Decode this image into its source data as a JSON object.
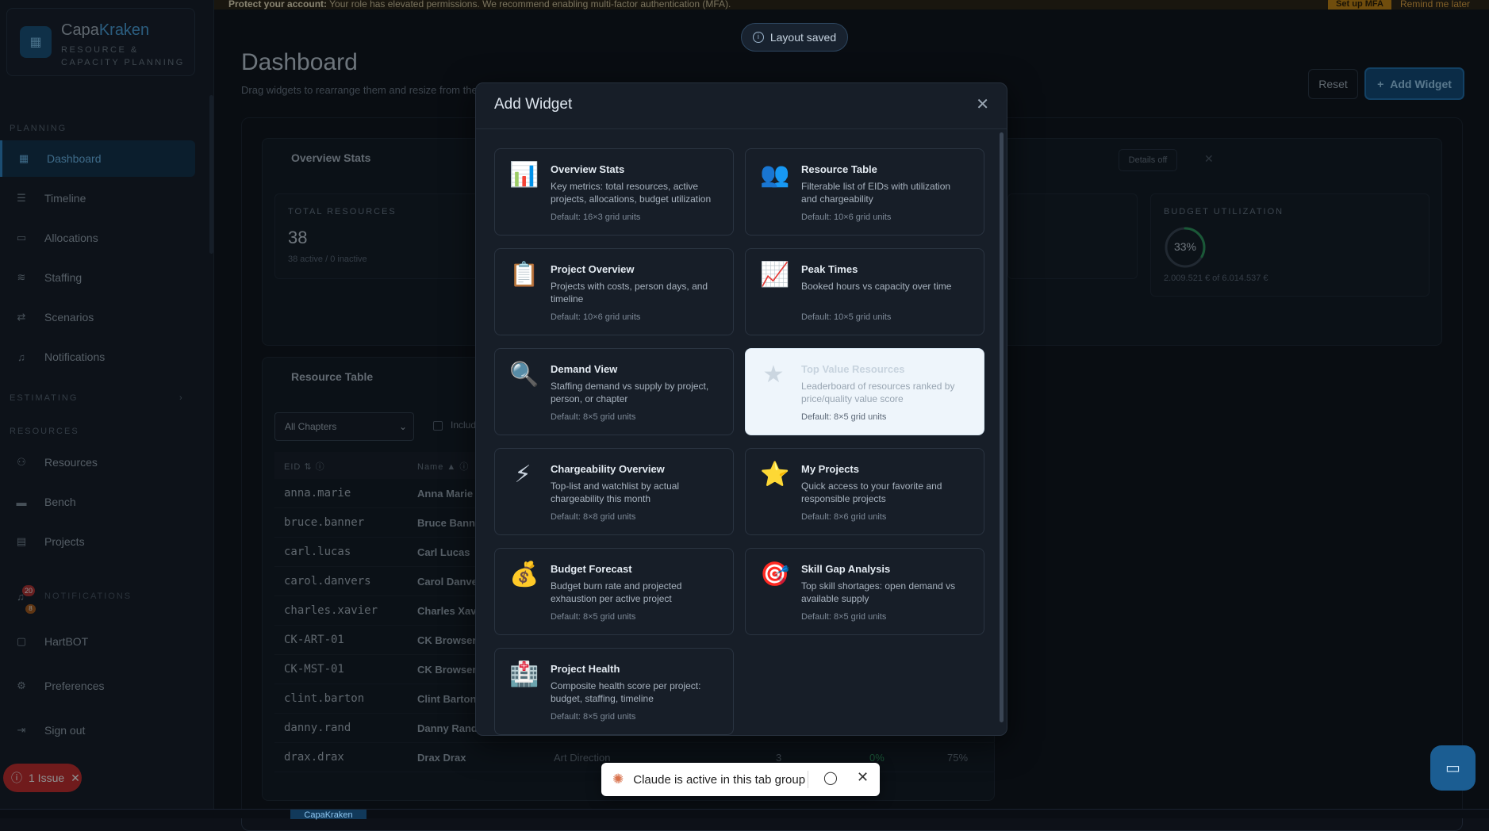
{
  "banner": {
    "bold": "Protect your account:",
    "text": " Your role has elevated permissions. We recommend enabling multi-factor authentication (MFA).",
    "mfa_button": "Set up MFA",
    "later_link": "Remind me later"
  },
  "brand": {
    "name_a": "Capa",
    "name_b": "Kraken",
    "subtitle": "RESOURCE & CAPACITY PLANNING"
  },
  "sidebar": {
    "planning_label": "PLANNING",
    "planning_items": [
      "Dashboard",
      "Timeline",
      "Allocations",
      "Staffing",
      "Scenarios",
      "Notifications"
    ],
    "estimating_label": "ESTIMATING",
    "resources_label": "RESOURCES",
    "resources_items": [
      "Resources",
      "Bench",
      "Projects"
    ],
    "notifications_label": "NOTIFICATIONS",
    "badge_red": "20",
    "badge_orange": "8",
    "bottom_items": [
      "HartBOT",
      "Preferences",
      "Sign out"
    ],
    "issue_label": "1 Issue"
  },
  "main": {
    "title": "Dashboard",
    "subtitle": "Drag widgets to rearrange them and resize from the",
    "reset": "Reset",
    "add_widget": "Add Widget",
    "overview_title": "Overview Stats",
    "details_off": "Details off",
    "stats": [
      {
        "label": "TOTAL RESOURCES",
        "value": "38",
        "sub": "38 active / 0 inactive"
      },
      {
        "label": "BUDGET UTILIZATION",
        "value": "33%",
        "sub": "2.009.521 € of 6.014.537 €",
        "percent": 33
      }
    ],
    "resource_table_title": "Resource Table",
    "chapter_select": "All Chapters",
    "include_label": "Includ",
    "col_eid": "EID",
    "col_name": "Name",
    "rows": [
      {
        "eid": "anna.marie",
        "name": "Anna Marie"
      },
      {
        "eid": "bruce.banner",
        "name": "Bruce Banne"
      },
      {
        "eid": "carl.lucas",
        "name": "Carl Lucas"
      },
      {
        "eid": "carol.danvers",
        "name": "Carol Danve"
      },
      {
        "eid": "charles.xavier",
        "name": "Charles Xavi"
      },
      {
        "eid": "CK-ART-01",
        "name": "CK Browser"
      },
      {
        "eid": "CK-MST-01",
        "name": "CK Browser"
      },
      {
        "eid": "clint.barton",
        "name": "Clint Barton"
      },
      {
        "eid": "danny.rand",
        "name": "Danny Rand"
      },
      {
        "eid": "drax.drax",
        "name": "Drax Drax",
        "chapter": "Art Direction",
        "n1": "3",
        "n2": "0%",
        "n3": "75%"
      }
    ]
  },
  "toast": {
    "text": "Layout saved"
  },
  "modal": {
    "title": "Add Widget",
    "widgets": [
      {
        "icon": "📊",
        "title": "Overview Stats",
        "desc": "Key metrics: total resources, active projects, allocations, budget utilization",
        "grid": "Default: 16×3 grid units"
      },
      {
        "icon": "👥",
        "title": "Resource Table",
        "desc": "Filterable list of EIDs with utilization and chargeability",
        "grid": "Default: 10×6 grid units"
      },
      {
        "icon": "📋",
        "title": "Project Overview",
        "desc": "Projects with costs, person days, and timeline",
        "grid": "Default: 10×6 grid units"
      },
      {
        "icon": "📈",
        "title": "Peak Times",
        "desc": "Booked hours vs capacity over time",
        "grid": "Default: 10×5 grid units"
      },
      {
        "icon": "🔍",
        "title": "Demand View",
        "desc": "Staffing demand vs supply by project, person, or chapter",
        "grid": "Default: 8×5 grid units"
      },
      {
        "icon": "★",
        "title": "Top Value Resources",
        "desc": "Leaderboard of resources ranked by price/quality value score",
        "grid": "Default: 8×5 grid units"
      },
      {
        "icon": "⚡",
        "title": "Chargeability Overview",
        "desc": "Top-list and watchlist by actual chargeability this month",
        "grid": "Default: 8×8 grid units"
      },
      {
        "icon": "⭐",
        "title": "My Projects",
        "desc": "Quick access to your favorite and responsible projects",
        "grid": "Default: 8×6 grid units"
      },
      {
        "icon": "💰",
        "title": "Budget Forecast",
        "desc": "Budget burn rate and projected exhaustion per active project",
        "grid": "Default: 8×5 grid units"
      },
      {
        "icon": "🎯",
        "title": "Skill Gap Analysis",
        "desc": "Top skill shortages: open demand vs available supply",
        "grid": "Default: 8×5 grid units"
      },
      {
        "icon": "🏥",
        "title": "Project Health",
        "desc": "Composite health score per project: budget, staffing, timeline",
        "grid": "Default: 8×5 grid units"
      }
    ]
  },
  "claude_bar": {
    "text": "Claude is active in this tab group"
  },
  "taskbar": {
    "tab": "CapaKraken"
  }
}
